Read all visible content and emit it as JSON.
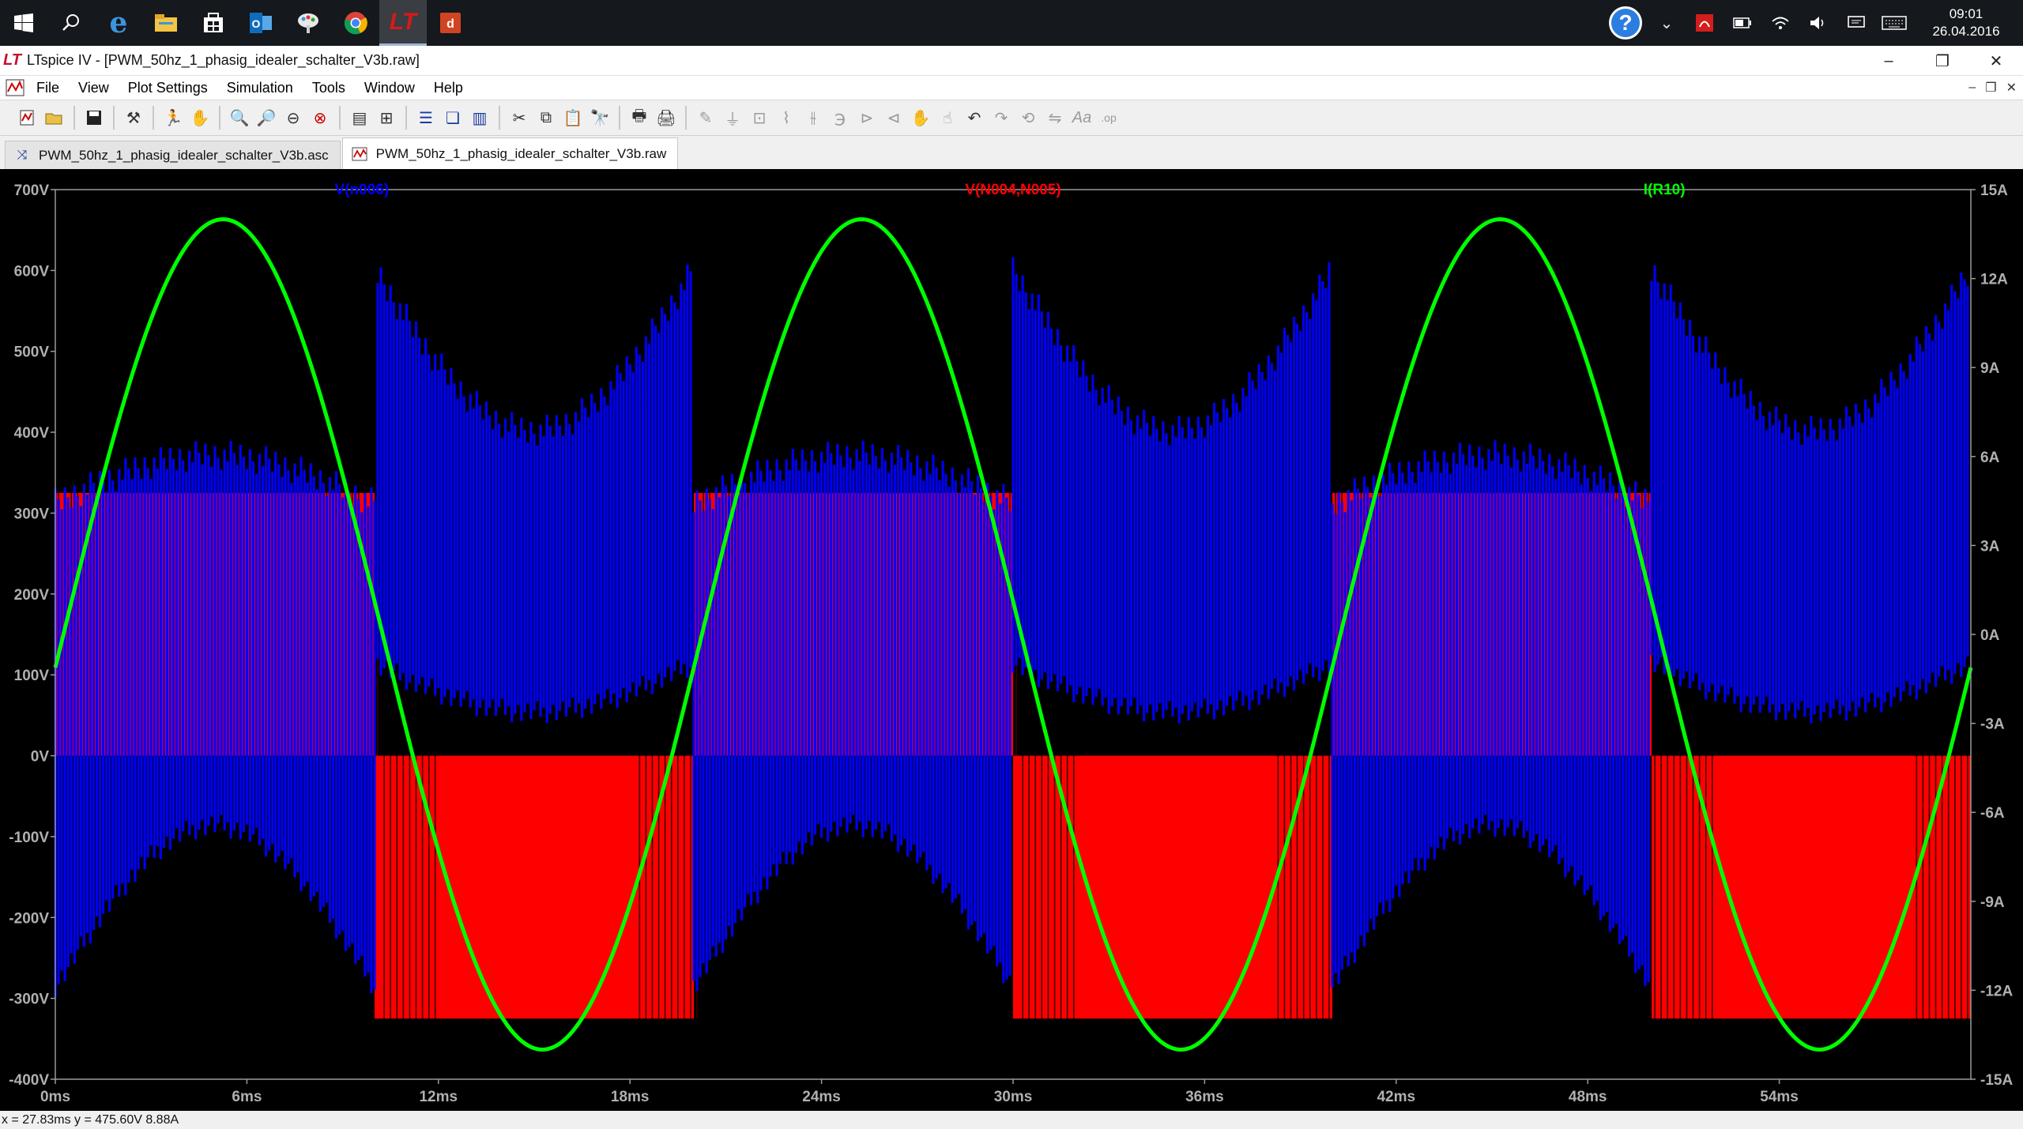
{
  "taskbar": {
    "apps": [
      {
        "name": "start-icon"
      },
      {
        "name": "search-icon"
      },
      {
        "name": "edge-icon"
      },
      {
        "name": "file-explorer-icon"
      },
      {
        "name": "store-icon"
      },
      {
        "name": "outlook-icon"
      },
      {
        "name": "paint-icon"
      },
      {
        "name": "chrome-icon"
      },
      {
        "name": "ltspice-icon"
      },
      {
        "name": "office-icon"
      }
    ],
    "clock_time": "09:01",
    "clock_date": "26.04.2016"
  },
  "window": {
    "title": "LTspice IV - [PWM_50hz_1_phasig_idealer_schalter_V3b.raw]",
    "minimize": "–",
    "restore": "❐",
    "close": "✕"
  },
  "menu": {
    "items": [
      "File",
      "View",
      "Plot Settings",
      "Simulation",
      "Tools",
      "Window",
      "Help"
    ]
  },
  "tabs": [
    {
      "label": "PWM_50hz_1_phasig_idealer_schalter_V3b.asc",
      "icon": "schematic-icon"
    },
    {
      "label": "PWM_50hz_1_phasig_idealer_schalter_V3b.raw",
      "icon": "waveform-icon"
    }
  ],
  "chart_data": {
    "type": "line",
    "xlabel": "",
    "x_ticks": [
      "0ms",
      "6ms",
      "12ms",
      "18ms",
      "24ms",
      "30ms",
      "36ms",
      "42ms",
      "48ms",
      "54ms"
    ],
    "xlim": [
      0,
      60
    ],
    "x_unit": "ms",
    "y_left_ticks": [
      "700V",
      "600V",
      "500V",
      "400V",
      "300V",
      "200V",
      "100V",
      "0V",
      "-100V",
      "-200V",
      "-300V",
      "-400V"
    ],
    "ylim_left": [
      -400,
      700
    ],
    "y_right_ticks": [
      "15A",
      "12A",
      "9A",
      "6A",
      "3A",
      "0A",
      "-3A",
      "-6A",
      "-9A",
      "-12A",
      "-15A"
    ],
    "ylim_right": [
      -15,
      15
    ],
    "grid": false,
    "series": [
      {
        "name": "V(n006)",
        "color": "#0000ff",
        "axis": "left",
        "description_values": {
          "carrier_hz": 50,
          "envelope_low_V": [
            -100,
            390
          ],
          "envelope_high_V": [
            -300,
            620
          ]
        }
      },
      {
        "name": "V(N004,N005)",
        "color": "#ff0000",
        "axis": "left",
        "levels_V": [
          325,
          0,
          -325
        ],
        "fundamental_hz": 50
      },
      {
        "name": "I(R10)",
        "color": "#00ff00",
        "axis": "right",
        "amplitude_A": 14,
        "fundamental_hz": 50,
        "phase_start_A": 0
      }
    ]
  },
  "status": {
    "cursor": "x = 27.83ms   y = 475.60V  8.88A"
  }
}
